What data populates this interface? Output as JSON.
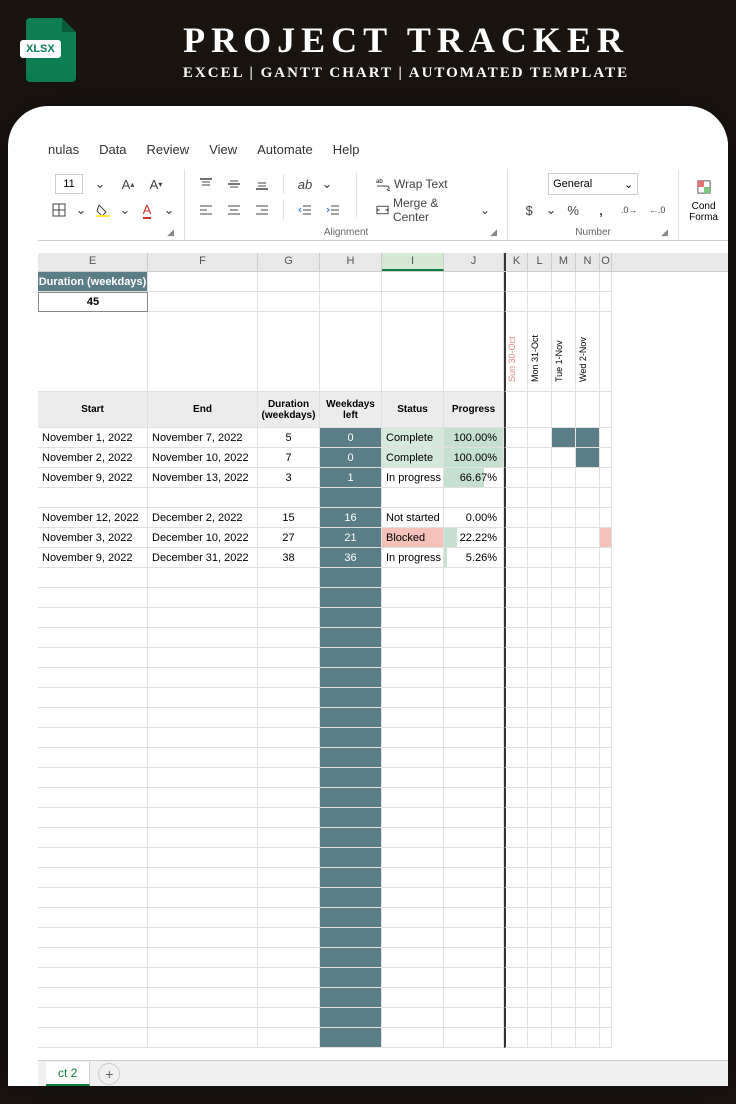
{
  "banner": {
    "title": "PROJECT TRACKER",
    "subtitle": "EXCEL | GANTT CHART | AUTOMATED TEMPLATE",
    "badge": "XLSX"
  },
  "menu": {
    "items": [
      "nulas",
      "Data",
      "Review",
      "View",
      "Automate",
      "Help"
    ]
  },
  "ribbon": {
    "fontsize": "11",
    "wrap_text": "Wrap Text",
    "merge_center": "Merge & Center",
    "number_format": "General",
    "cond_format": "Cond\nForma",
    "groups": {
      "alignment": "Alignment",
      "number": "Number"
    }
  },
  "columns": [
    "E",
    "F",
    "G",
    "H",
    "I",
    "J",
    "K",
    "L",
    "M",
    "N",
    "O"
  ],
  "selected_col": "I",
  "duration_header": "Duration (weekdays)",
  "duration_value": "45",
  "table_headers": {
    "start": "Start",
    "end": "End",
    "duration": "Duration (weekdays)",
    "weekdays_left": "Weekdays left",
    "status": "Status",
    "progress": "Progress"
  },
  "date_cols": [
    {
      "label": "Sun 30-Oct",
      "weekend": true
    },
    {
      "label": "Mon 31-Oct",
      "weekend": false
    },
    {
      "label": "Tue 1-Nov",
      "weekend": false
    },
    {
      "label": "Wed 2-Nov",
      "weekend": false
    }
  ],
  "rows": [
    {
      "start": "November 1, 2022",
      "end": "November 7, 2022",
      "duration": "5",
      "left": "0",
      "status": "Complete",
      "status_class": "complete",
      "progress": "100.00%",
      "pbar": 100,
      "gantt": [
        0,
        0,
        1,
        1,
        0
      ]
    },
    {
      "start": "November 2, 2022",
      "end": "November 10, 2022",
      "duration": "7",
      "left": "0",
      "status": "Complete",
      "status_class": "complete",
      "progress": "100.00%",
      "pbar": 100,
      "gantt": [
        0,
        0,
        0,
        1,
        0
      ]
    },
    {
      "start": "November 9, 2022",
      "end": "November 13, 2022",
      "duration": "3",
      "left": "1",
      "status": "In progress",
      "status_class": "",
      "progress": "66.67%",
      "pbar": 67,
      "gantt": [
        0,
        0,
        0,
        0,
        0
      ]
    },
    null,
    {
      "start": "November 12, 2022",
      "end": "December 2, 2022",
      "duration": "15",
      "left": "16",
      "status": "Not started",
      "status_class": "",
      "progress": "0.00%",
      "pbar": 0,
      "gantt": [
        0,
        0,
        0,
        0,
        0
      ]
    },
    {
      "start": "November 3, 2022",
      "end": "December 10, 2022",
      "duration": "27",
      "left": "21",
      "status": "Blocked",
      "status_class": "blocked",
      "progress": "22.22%",
      "pbar": 22,
      "gantt": [
        0,
        0,
        0,
        0,
        2
      ]
    },
    {
      "start": "November 9, 2022",
      "end": "December 31, 2022",
      "duration": "38",
      "left": "36",
      "status": "In progress",
      "status_class": "",
      "progress": "5.26%",
      "pbar": 5,
      "gantt": [
        0,
        0,
        0,
        0,
        0
      ]
    }
  ],
  "sheet": {
    "active": "ct 2",
    "add": "+"
  },
  "chart_data": {
    "type": "table",
    "title": "Project Tracker Gantt",
    "columns": [
      "Start",
      "End",
      "Duration (weekdays)",
      "Weekdays left",
      "Status",
      "Progress"
    ],
    "rows": [
      [
        "November 1, 2022",
        "November 7, 2022",
        5,
        0,
        "Complete",
        "100.00%"
      ],
      [
        "November 2, 2022",
        "November 10, 2022",
        7,
        0,
        "Complete",
        "100.00%"
      ],
      [
        "November 9, 2022",
        "November 13, 2022",
        3,
        1,
        "In progress",
        "66.67%"
      ],
      [
        "November 12, 2022",
        "December 2, 2022",
        15,
        16,
        "Not started",
        "0.00%"
      ],
      [
        "November 3, 2022",
        "December 10, 2022",
        27,
        21,
        "Blocked",
        "22.22%"
      ],
      [
        "November 9, 2022",
        "December 31, 2022",
        38,
        36,
        "In progress",
        "5.26%"
      ]
    ],
    "overall_duration_weekdays": 45
  }
}
